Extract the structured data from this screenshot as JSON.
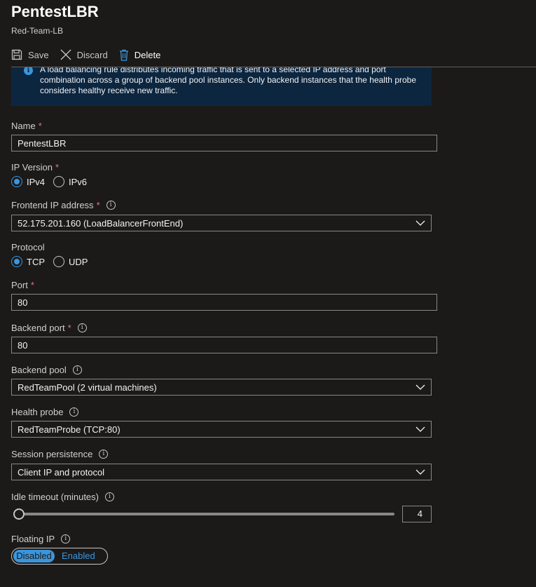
{
  "header": {
    "title": "PentestLBR",
    "subtitle": "Red-Team-LB"
  },
  "toolbar": {
    "save_label": "Save",
    "discard_label": "Discard",
    "delete_label": "Delete"
  },
  "info_banner": {
    "text": "A load balancing rule distributes incoming traffic that is sent to a selected IP address and port combination across a group of backend pool instances. Only backend instances that the health probe considers healthy receive new traffic."
  },
  "form": {
    "name": {
      "label": "Name",
      "required": "*",
      "value": "PentestLBR"
    },
    "ip_version": {
      "label": "IP Version",
      "required": "*",
      "options": [
        "IPv4",
        "IPv6"
      ],
      "selected": "IPv4"
    },
    "frontend_ip": {
      "label": "Frontend IP address",
      "required": "*",
      "value": "52.175.201.160 (LoadBalancerFrontEnd)"
    },
    "protocol": {
      "label": "Protocol",
      "options": [
        "TCP",
        "UDP"
      ],
      "selected": "TCP"
    },
    "port": {
      "label": "Port",
      "required": "*",
      "value": "80"
    },
    "backend_port": {
      "label": "Backend port",
      "required": "*",
      "value": "80"
    },
    "backend_pool": {
      "label": "Backend pool",
      "value": "RedTeamPool (2 virtual machines)"
    },
    "health_probe": {
      "label": "Health probe",
      "value": "RedTeamProbe (TCP:80)"
    },
    "session_persistence": {
      "label": "Session persistence",
      "value": "Client IP and protocol"
    },
    "idle_timeout": {
      "label": "Idle timeout (minutes)",
      "value": "4"
    },
    "floating_ip": {
      "label": "Floating IP",
      "options": [
        "Disabled",
        "Enabled"
      ],
      "selected": "Disabled"
    }
  },
  "colors": {
    "accent": "#3a96dd",
    "required": "#f1707b",
    "banner_bg": "#0c2640",
    "page_bg": "#1b1a19"
  },
  "icons": {
    "save": "save-icon",
    "discard": "close-icon",
    "delete": "trash-icon",
    "info": "info-icon",
    "chevron": "chevron-down-icon"
  }
}
